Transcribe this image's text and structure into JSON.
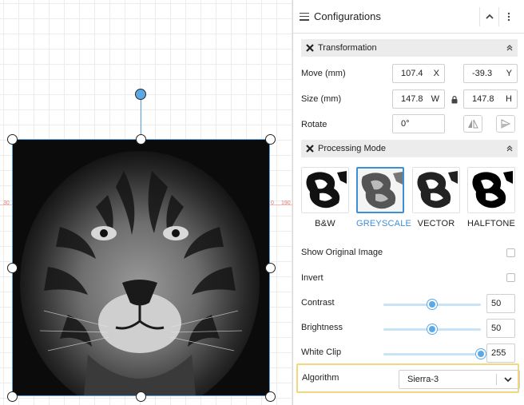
{
  "canvas": {
    "ruler": {
      "left_num": "30",
      "mid_num": "0",
      "right_num": "190"
    }
  },
  "panel": {
    "title": "Configurations",
    "transformation": {
      "title": "Transformation",
      "move_label": "Move (mm)",
      "move_x": "107.4",
      "move_x_unit": "X",
      "move_y": "-39.3",
      "move_y_unit": "Y",
      "size_label": "Size (mm)",
      "size_w": "147.8",
      "size_w_unit": "W",
      "size_h": "147.8",
      "size_h_unit": "H",
      "rotate_label": "Rotate",
      "rotate_value": "0°"
    },
    "processing": {
      "title": "Processing Mode",
      "modes": [
        {
          "label": "B&W",
          "selected": false
        },
        {
          "label": "GREYSCALE",
          "selected": true
        },
        {
          "label": "VECTOR",
          "selected": false
        },
        {
          "label": "HALFTONE",
          "selected": false
        }
      ],
      "show_original_label": "Show Original Image",
      "show_original_checked": false,
      "invert_label": "Invert",
      "invert_checked": false,
      "contrast_label": "Contrast",
      "contrast_value": "50",
      "brightness_label": "Brightness",
      "brightness_value": "50",
      "white_clip_label": "White Clip",
      "white_clip_value": "255",
      "algorithm_label": "Algorithm",
      "algorithm_value": "Sierra-3"
    }
  },
  "colors": {
    "accent": "#3d8fd8",
    "handle": "#5aa9e6",
    "highlight": "#f3d77f"
  }
}
